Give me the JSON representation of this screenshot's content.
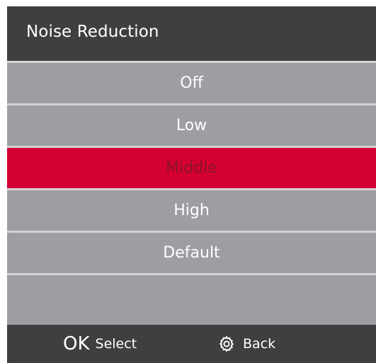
{
  "header": {
    "title": "Noise Reduction"
  },
  "menu": {
    "items": [
      {
        "label": "Off",
        "selected": false
      },
      {
        "label": "Low",
        "selected": false
      },
      {
        "label": "Middle",
        "selected": true
      },
      {
        "label": "High",
        "selected": false
      },
      {
        "label": "Default",
        "selected": false
      },
      {
        "label": "",
        "selected": false
      }
    ]
  },
  "footer": {
    "ok_glyph": "OK",
    "select_label": "Select",
    "back_icon": "gear-icon",
    "back_label": "Back"
  },
  "colors": {
    "header_bg": "#3f3f3f",
    "row_bg": "#9d9ea2",
    "selected_bg": "#d50032",
    "selected_text": "#8a1425",
    "divider": "#d3d3d5"
  }
}
